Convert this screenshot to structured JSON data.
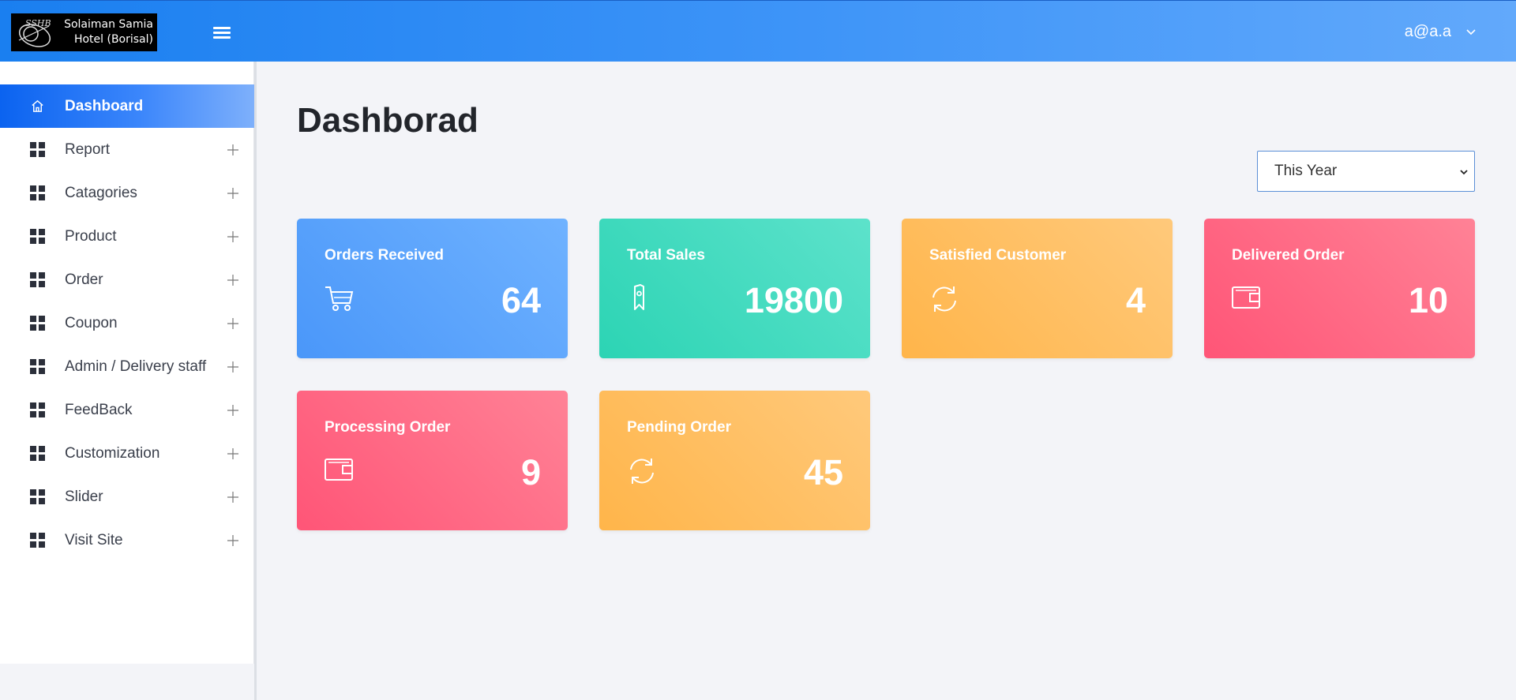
{
  "header": {
    "logo_lines": [
      "Solaiman Samia",
      "Hotel (Borisal)"
    ],
    "logo_mark_text": "SSHB",
    "user_email": "a@a.a"
  },
  "sidebar": {
    "items": [
      {
        "label": "Dashboard",
        "icon": "home-icon",
        "active": true
      },
      {
        "label": "Report",
        "icon": "grid-icon",
        "expandable": true
      },
      {
        "label": "Catagories",
        "icon": "grid-icon",
        "expandable": true
      },
      {
        "label": "Product",
        "icon": "grid-icon",
        "expandable": true
      },
      {
        "label": "Order",
        "icon": "grid-icon",
        "expandable": true
      },
      {
        "label": "Coupon",
        "icon": "grid-icon",
        "expandable": true
      },
      {
        "label": "Admin / Delivery staff",
        "icon": "grid-icon",
        "expandable": true
      },
      {
        "label": "FeedBack",
        "icon": "grid-icon",
        "expandable": true
      },
      {
        "label": "Customization",
        "icon": "grid-icon",
        "expandable": true
      },
      {
        "label": "Slider",
        "icon": "grid-icon",
        "expandable": true
      },
      {
        "label": "Visit Site",
        "icon": "grid-icon",
        "expandable": true
      }
    ]
  },
  "main": {
    "title": "Dashborad",
    "period_select": {
      "value": "This Year"
    },
    "cards": [
      {
        "title": "Orders Received",
        "value": "64",
        "icon": "cart-icon",
        "color": "#4a97f9"
      },
      {
        "title": "Total Sales",
        "value": "19800",
        "icon": "tag-icon",
        "color": "#2cd4b4"
      },
      {
        "title": "Satisfied Customer",
        "value": "4",
        "icon": "refresh-icon",
        "color": "#ffb54a"
      },
      {
        "title": "Delivered Order",
        "value": "10",
        "icon": "wallet-icon",
        "color": "#ff5577"
      },
      {
        "title": "Processing Order",
        "value": "9",
        "icon": "wallet-icon",
        "color": "#ff5577"
      },
      {
        "title": "Pending Order",
        "value": "45",
        "icon": "refresh-icon",
        "color": "#ffb54a"
      }
    ]
  },
  "colors": {
    "header_start": "#1a7ff0",
    "header_end": "#62a9fb",
    "active_nav": "#0b63f0",
    "page_bg": "#f3f4f8"
  }
}
